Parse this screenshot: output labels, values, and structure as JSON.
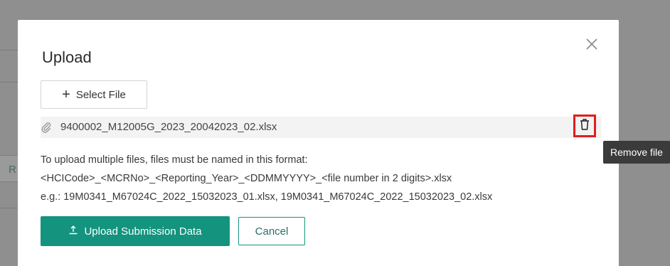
{
  "dialog": {
    "title": "Upload",
    "close_icon": "close-icon",
    "select_file_label": "Select File",
    "file": {
      "name": "9400002_M12005G_2023_20042023_02.xlsx",
      "attachment_icon": "paperclip-icon",
      "remove_icon": "trash-icon"
    },
    "info": {
      "line1": "To upload multiple files, files must be named in this format:",
      "line2": "<HCICode>_<MCRNo>_<Reporting_Year>_<DDMMYYYY>_<file number in 2 digits>.xlsx",
      "line3": "e.g.: 19M0341_M67024C_2022_15032023_01.xlsx, 19M0341_M67024C_2022_15032023_02.xlsx"
    },
    "upload_button_label": "Upload Submission Data",
    "cancel_button_label": "Cancel"
  },
  "tooltip": {
    "text": "Remove file"
  },
  "background": {
    "fragment_text": "R"
  },
  "colors": {
    "accent": "#14937f",
    "highlight_border": "#e01e1e",
    "tooltip_bg": "#3b3b3b"
  }
}
